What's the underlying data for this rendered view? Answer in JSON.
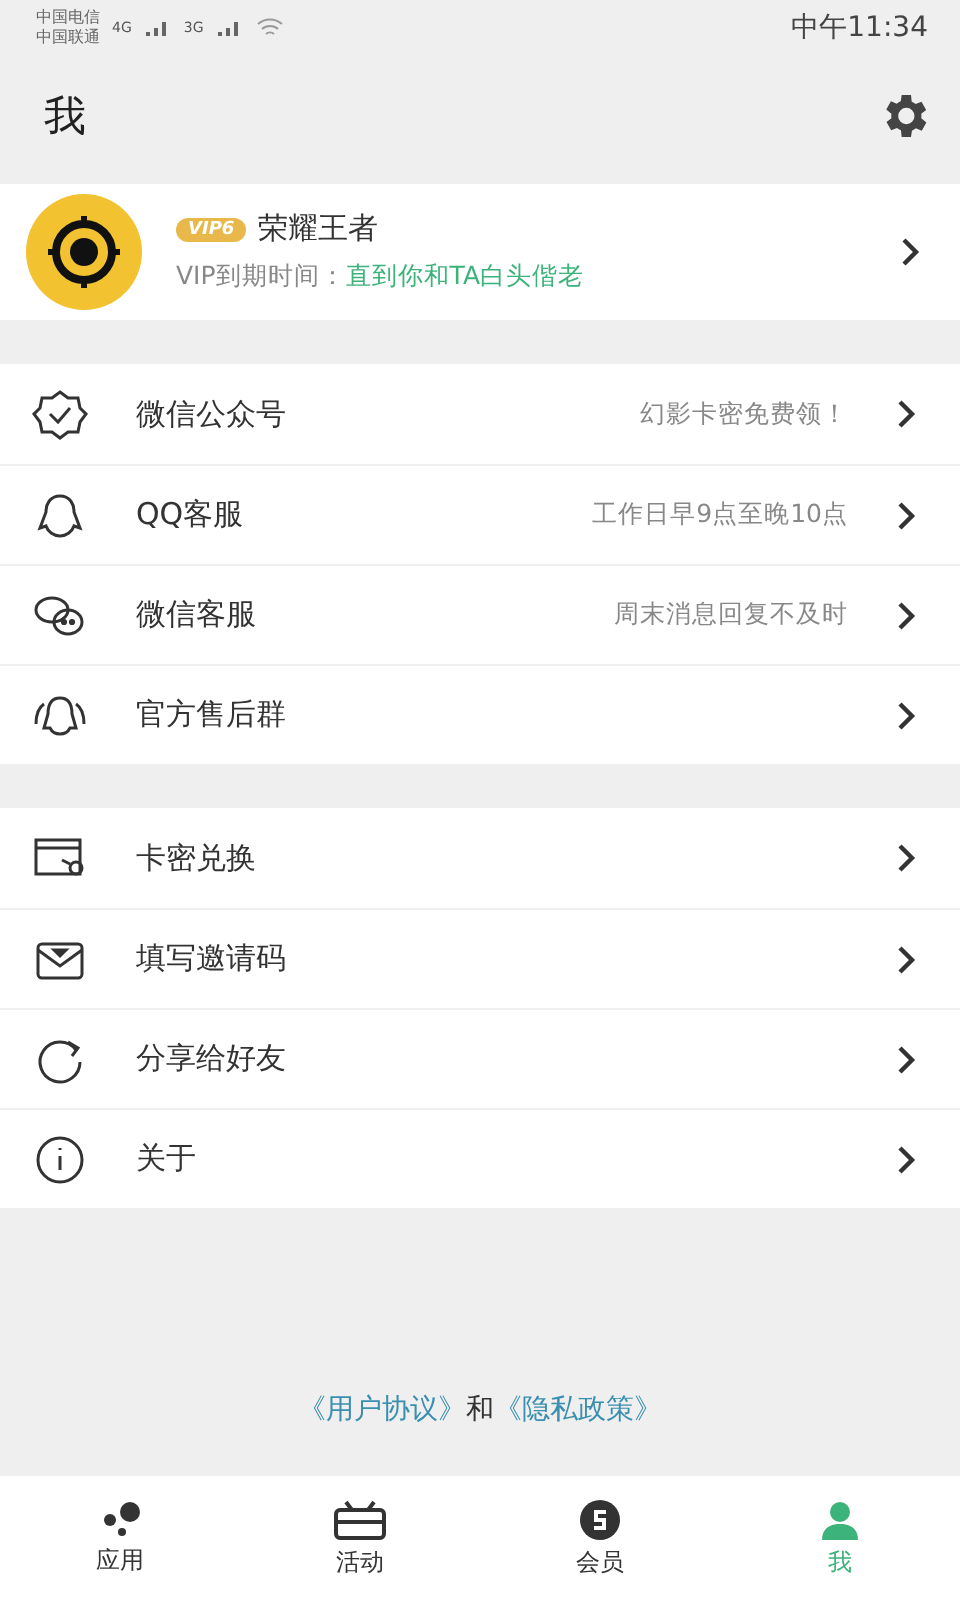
{
  "status_bar": {
    "carriers": [
      "中国电信",
      "中国联通"
    ],
    "networks": [
      "4G",
      "3G"
    ],
    "time": "中午11:34"
  },
  "header": {
    "title": "我"
  },
  "profile": {
    "badge": "VIP6",
    "name": "荣耀王者",
    "expiry_label": "VIP到期时间：",
    "expiry_value": "直到你和TA白头偕老"
  },
  "groups": [
    [
      {
        "label": "微信公众号",
        "note": "幻影卡密免费领！"
      },
      {
        "label": "QQ客服",
        "note": "工作日早9点至晚10点"
      },
      {
        "label": "微信客服",
        "note": "周末消息回复不及时"
      },
      {
        "label": "官方售后群"
      }
    ],
    [
      {
        "label": "卡密兑换"
      },
      {
        "label": "填写邀请码"
      },
      {
        "label": "分享给好友"
      },
      {
        "label": "关于"
      }
    ]
  ],
  "footer": {
    "user_agreement": "《用户协议》",
    "joiner": "和",
    "privacy_policy": "《隐私政策》"
  },
  "tabs": [
    {
      "label": "应用",
      "selected": false
    },
    {
      "label": "活动",
      "selected": false
    },
    {
      "label": "会员",
      "selected": false
    },
    {
      "label": "我",
      "selected": true
    }
  ]
}
